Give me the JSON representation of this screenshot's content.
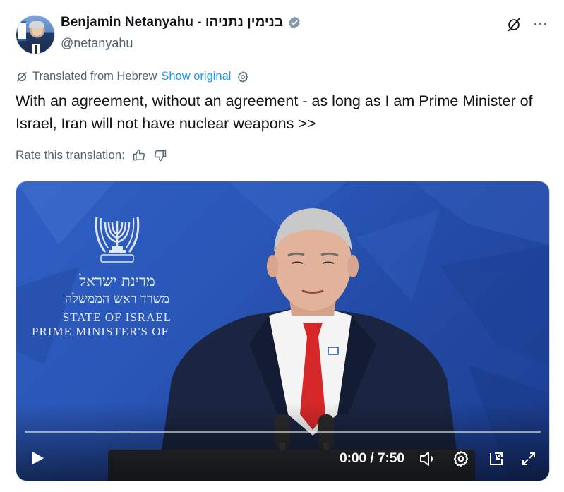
{
  "author": {
    "display_name": "Benjamin Netanyahu - בנימין נתניהו",
    "handle": "@netanyahu"
  },
  "translation": {
    "label": "Translated from Hebrew",
    "show_original": "Show original"
  },
  "tweet": {
    "text": "With an agreement, without an agreement - as long as I am Prime Minister of Israel, Iran will not have nuclear weapons >>"
  },
  "rating": {
    "label": "Rate this translation:"
  },
  "video": {
    "backdrop": {
      "hebrew_line1": "מדינת ישראל",
      "hebrew_line2": "משרד ראש הממשלה",
      "english_line1": "STATE OF ISRAEL",
      "english_line2": "PRIME MINISTER'S OF",
      "emblem_caption": "ישראל"
    },
    "time": "0:00 / 7:50",
    "progress": 0
  },
  "icons": {
    "verified": "verified-badge-icon",
    "grok": "grok-icon",
    "more": "more-icon",
    "translate": "translate-icon",
    "settings": "gear-icon",
    "thumbs_up": "thumbs-up-icon",
    "thumbs_down": "thumbs-down-icon",
    "play": "play-icon",
    "volume": "volume-icon",
    "video_settings": "gear-icon",
    "dock": "dock-icon",
    "fullscreen": "fullscreen-icon"
  },
  "colors": {
    "link": "#1d9bf0",
    "secondary_text": "#536471",
    "primary_text": "#0f1419",
    "verified_badge": "#829aab",
    "video_bg": "#2a57b8"
  }
}
